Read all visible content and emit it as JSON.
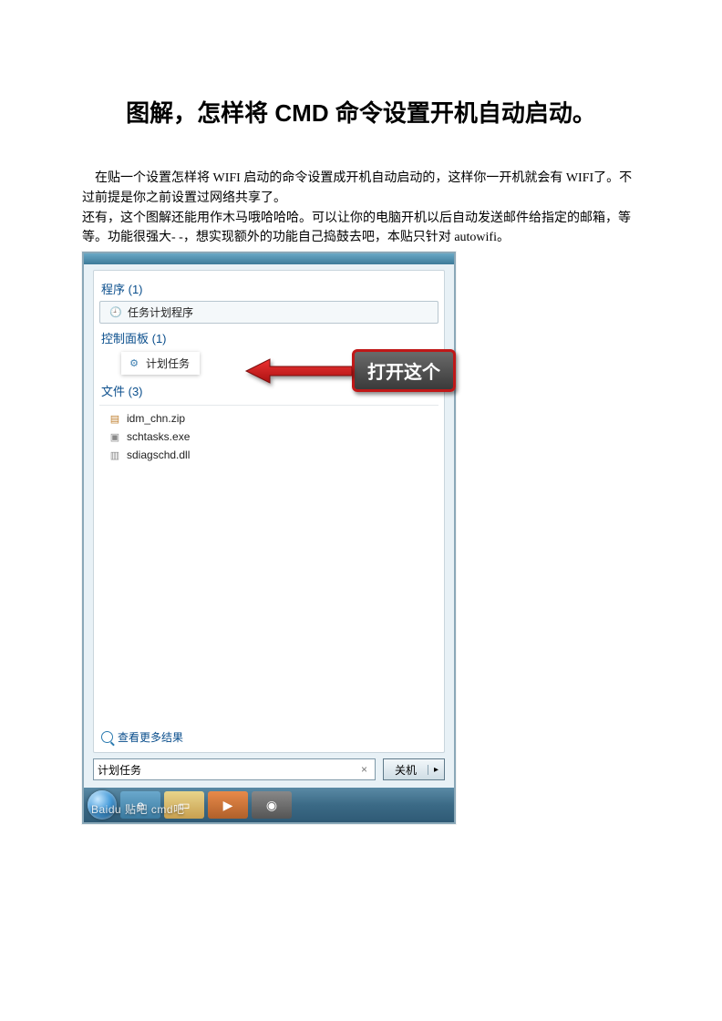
{
  "title": "图解，怎样将 CMD 命令设置开机自动启动。",
  "para1": "在贴一个设置怎样将 WIFI 启动的命令设置成开机自动启动的，这样你一开机就会有 WIFI了。不过前提是你之前设置过网络共享了。",
  "para2": "还有，这个图解还能用作木马哦哈哈哈。可以让你的电脑开机以后自动发送邮件给指定的邮箱，等等。功能很强大- -，想实现额外的功能自己捣鼓去吧，本贴只针对 autowifi。",
  "startmenu": {
    "programs_head": "程序 (1)",
    "programs_item": "任务计划程序",
    "cpl_head": "控制面板 (1)",
    "cpl_item": "计划任务",
    "files_head": "文件 (3)",
    "files": [
      "idm_chn.zip",
      "schtasks.exe",
      "sdiagschd.dll"
    ],
    "more": "查看更多结果",
    "search_value": "计划任务",
    "shutdown": "关机"
  },
  "callout": "打开这个",
  "watermark": "Baidu 贴吧  cmd吧"
}
